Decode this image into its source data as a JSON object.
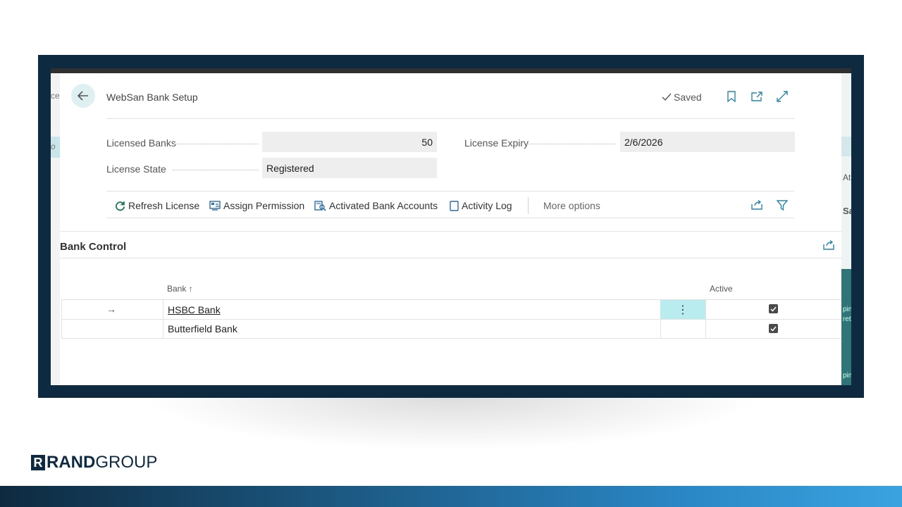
{
  "page": {
    "title": "WebSan Bank Setup",
    "status": "Saved"
  },
  "fields": {
    "licensed_banks_label": "Licensed Banks",
    "licensed_banks_value": "50",
    "license_expiry_label": "License Expiry",
    "license_expiry_value": "2/6/2026",
    "license_state_label": "License State",
    "license_state_value": "Registered"
  },
  "actions": {
    "refresh_license": "Refresh License",
    "assign_permission": "Assign Permission",
    "activated_bank_accounts": "Activated Bank Accounts",
    "activity_log": "Activity Log",
    "more_options": "More options"
  },
  "bank_control": {
    "title": "Bank Control",
    "columns": {
      "bank": "Bank",
      "sort_indicator": "↑",
      "active": "Active"
    },
    "rows": [
      {
        "bank": "HSBC Bank",
        "active": true,
        "selected": true
      },
      {
        "bank": "Butterfield Bank",
        "active": true,
        "selected": false
      }
    ]
  },
  "row_marker": "→",
  "row_menu_glyph": "⋮",
  "background_fragments": {
    "left_1": "ce",
    "left_2": "o",
    "right_1": "At",
    "right_2": "Sa",
    "right_3": "pin",
    "right_4": "ret",
    "right_5": "pin"
  },
  "brand": {
    "logo_mark": "R",
    "logo_text_bold": "RAND",
    "logo_text": "GROUP"
  },
  "colors": {
    "frame": "#0e2a40",
    "accent_teal": "#00a2ad",
    "selected_cell": "#b8ecee",
    "field_background": "#eeeeee"
  },
  "icons": {
    "back": "arrow-left-icon",
    "saved": "checkmark-icon",
    "bookmark": "bookmark-icon",
    "open_new_window": "open-in-new-window-icon",
    "expand": "expand-icon",
    "refresh": "refresh-icon",
    "assign_permission": "permission-icon",
    "activated_bank_accounts": "bank-search-icon",
    "activity_log": "document-icon",
    "share": "share-icon",
    "filter": "filter-icon"
  }
}
